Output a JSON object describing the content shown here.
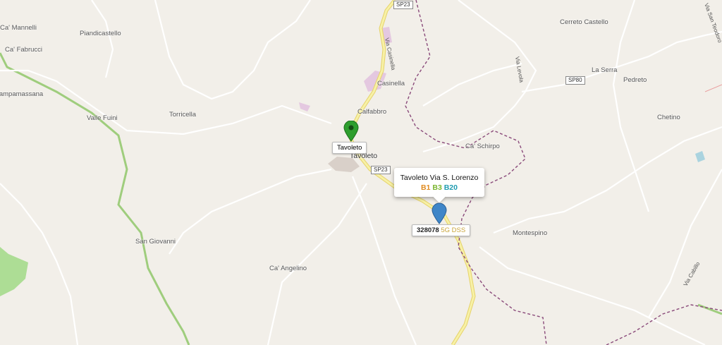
{
  "places": [
    {
      "name": "Ca' Mannelli"
    },
    {
      "name": "Piandicastello"
    },
    {
      "name": "Ca' Fabrucci"
    },
    {
      "name": "Campamassana"
    },
    {
      "name": "Valle Fuini"
    },
    {
      "name": "Torricella"
    },
    {
      "name": "Casinella"
    },
    {
      "name": "Calfabbro"
    },
    {
      "name": "Tavoleto"
    },
    {
      "name": "Ca' Schirpo"
    },
    {
      "name": "Cerreto Castello"
    },
    {
      "name": "La Serra"
    },
    {
      "name": "Pedreto"
    },
    {
      "name": "Chetino"
    },
    {
      "name": "Montespino"
    },
    {
      "name": "San Giovanni"
    },
    {
      "name": "Ca' Angelino"
    }
  ],
  "road_shields": [
    "SP23",
    "SP80",
    "SP23"
  ],
  "road_labels": [
    "Via Casinella",
    "Via Levola",
    "Via San Teodoro",
    "Via Cabillo"
  ],
  "green_marker": {
    "label": "Tavoleto",
    "color": "#2e9e2e"
  },
  "blue_marker": {
    "color": "#3f86c8"
  },
  "popup": {
    "title": "Tavoleto Via S. Lorenzo",
    "bands": [
      {
        "text": "B1",
        "color": "#e08a1e"
      },
      {
        "text": "B3",
        "color": "#7ab52f"
      },
      {
        "text": "B20",
        "color": "#1e9bb0"
      }
    ]
  },
  "site_label": {
    "id": "328078",
    "tech": "5G DSS",
    "tech_color": "#c9a43a"
  }
}
